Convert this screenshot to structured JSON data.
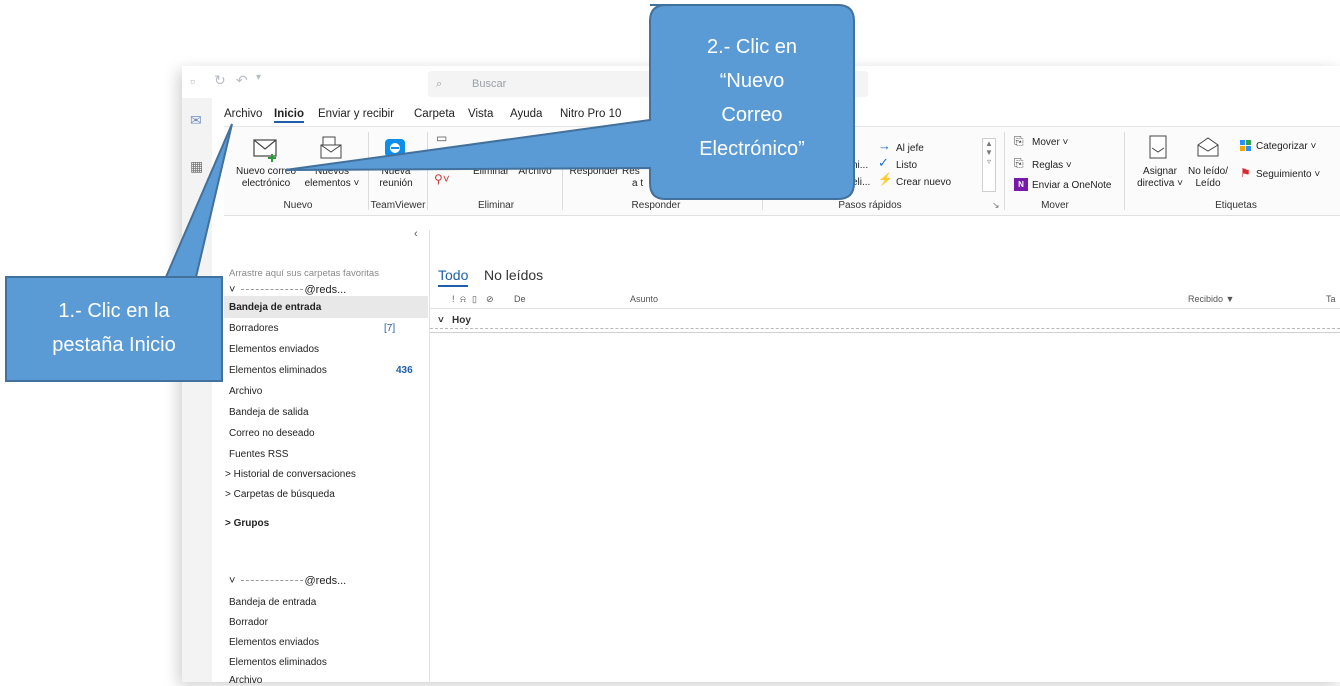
{
  "toolbar": {
    "search_placeholder": "Buscar"
  },
  "menu": [
    "Archivo",
    "Inicio",
    "Enviar y recibir",
    "Carpeta",
    "Vista",
    "Ayuda",
    "Nitro Pro 10"
  ],
  "ribbon": {
    "nuevo_correo": [
      "Nuevo correo",
      "electrónico"
    ],
    "nuevos_elementos": [
      "Nuevos",
      "elementos ˅"
    ],
    "nueva_reunion": [
      "Nueva",
      "reunión"
    ],
    "eliminar": "Eliminar",
    "archivo": "Archivo",
    "responder": "Responder",
    "responder_todos": [
      "Res",
      "a t"
    ],
    "quick_steps_left": [
      "ni...",
      "eli..."
    ],
    "al_jefe": "Al jefe",
    "listo": "Listo",
    "crear_nuevo": "Crear nuevo",
    "mover": "Mover ˅",
    "reglas": "Reglas ˅",
    "enviar_onenote": "Enviar a OneNote",
    "asignar_directiva": [
      "Asignar",
      "directiva ˅"
    ],
    "no_leido": [
      "No leído/",
      "Leído"
    ],
    "categorizar": "Categorizar ˅",
    "seguimiento": "Seguimiento ˅",
    "groups": {
      "nuevo": "Nuevo",
      "teamviewer": "TeamViewer",
      "eliminar": "Eliminar",
      "responder": "Responder",
      "pasos_rapidos": "Pasos rápidos",
      "mover": "Mover",
      "etiquetas": "Etiquetas"
    }
  },
  "folders": {
    "favorites_hint": "Arrastre aquí sus carpetas favoritas",
    "account1": "@reds...",
    "account1_items": [
      {
        "label": "Bandeja de entrada",
        "count": ""
      },
      {
        "label": "Borradores",
        "count": "[7]"
      },
      {
        "label": "Elementos enviados",
        "count": ""
      },
      {
        "label": "Elementos eliminados",
        "count": "436"
      },
      {
        "label": "Archivo",
        "count": ""
      },
      {
        "label": "Bandeja de salida",
        "count": ""
      },
      {
        "label": "Correo no deseado",
        "count": ""
      },
      {
        "label": "Fuentes RSS",
        "count": ""
      },
      {
        "label": "> Historial de conversaciones",
        "count": ""
      },
      {
        "label": "> Carpetas de búsqueda",
        "count": ""
      }
    ],
    "grupos": "> Grupos",
    "account2": "@reds...",
    "account2_items": [
      "Bandeja de entrada",
      "Borrador",
      "Elementos enviados",
      "Elementos eliminados",
      "Archivo"
    ]
  },
  "messages": {
    "tab_todo": "Todo",
    "tab_no_leidos": "No leídos",
    "col_de": "De",
    "col_asunto": "Asunto",
    "col_recibido": "Recibido ▼",
    "col_ta": "Ta",
    "group_hoy": "Hoy"
  },
  "callouts": {
    "step1": [
      "1.- Clic en la",
      "pestaña Inicio"
    ],
    "step2": [
      "2.- Clic en",
      "“Nuevo",
      "Correo",
      "Electrónico”"
    ],
    "fill": "#5b9bd5",
    "stroke": "#41719c"
  }
}
